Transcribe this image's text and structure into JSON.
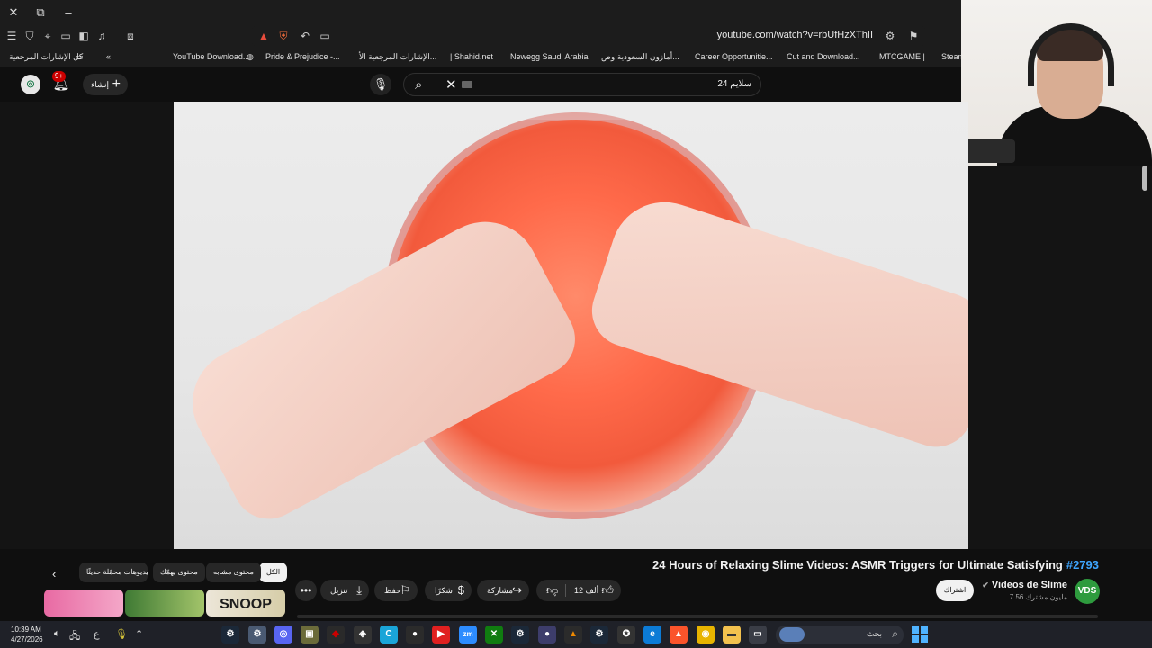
{
  "browser": {
    "url": "youtube.com/watch?v=rbUfHzXThII",
    "bookmarks": [
      "كل الإشارات المرجعية",
      "YouTube Download...",
      "Pride & Prejudice -...",
      "الإشارات المرجعية الأ...",
      "| Shahid.net",
      "Newegg Saudi Arabia",
      "أمازون السعودية وص...",
      "Career Opportunitie...",
      "Cut and Download...",
      "MTCGAME |",
      "Steam"
    ]
  },
  "youtube_header": {
    "notification_count": "9+",
    "create_label": "إنشاء",
    "search_query": "سلايم 24"
  },
  "video": {
    "title": "24 Hours of Relaxing Slime Videos: ASMR Triggers for Ultimate Satisfying",
    "hashtag": "#2793",
    "channel_name": "Videos de Slime",
    "channel_avatar_text": "VDS",
    "subscribers": "7.56 مليون مشترك",
    "subscribe_label": "اشتراك",
    "like_count": "12 ألف",
    "share_label": "مشاركة",
    "thanks_label": "شكرًا",
    "save_label": "حفظ",
    "download_label": "تنزيل",
    "more_label": "•••"
  },
  "chips": {
    "all": "الكل",
    "related": "محتوى مشابه",
    "for_you": "محتوى يهمّك",
    "recent": "فيديوهات محمّلة حديثًا"
  },
  "thumbnails": {
    "third_text": "SNOOP"
  },
  "taskbar": {
    "time": "10:39 AM",
    "date": "4/27/2026",
    "lang": "ع",
    "search_placeholder": "بحث",
    "zoom_label": "zm"
  }
}
